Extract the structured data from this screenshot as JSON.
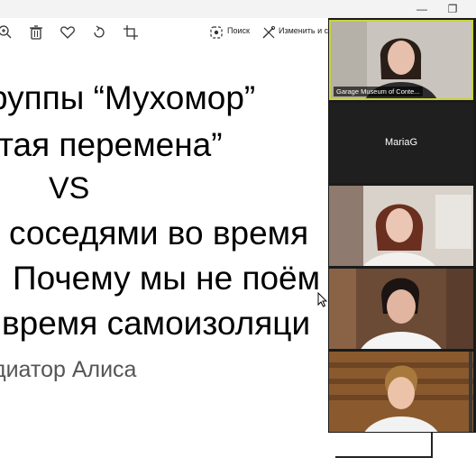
{
  "toolbar": {
    "search_label": "Поиск",
    "edit_label": "Изменить и со"
  },
  "slide": {
    "lines": [
      "руппы “Мухомор”",
      "тая перемена”",
      "VS",
      "соседями во время",
      "Почему мы не поём",
      "время самоизоляци",
      "диатор Алиса"
    ]
  },
  "gallery": {
    "tile1_name": "Garage Museum of Conte...",
    "tile2_name": "MariaG"
  },
  "colors": {
    "active_speaker_border": "#c8d43b",
    "gallery_bg": "#1a1a1a"
  }
}
